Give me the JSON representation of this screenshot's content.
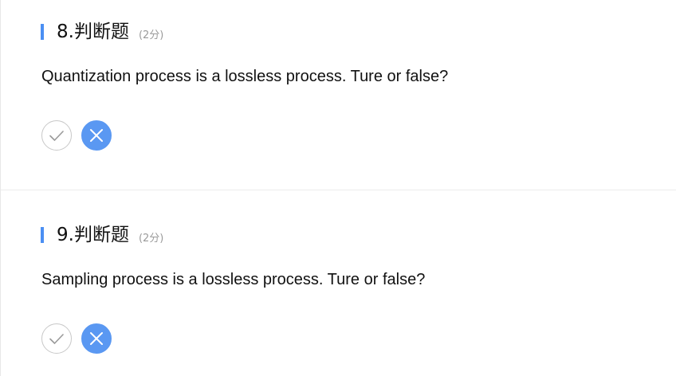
{
  "questions": [
    {
      "title": "8.判断题",
      "score": "(2分)",
      "text": "Quantization process is a lossless process. Ture or false?",
      "options": [
        {
          "icon": "check-icon",
          "selected": false
        },
        {
          "icon": "cross-icon",
          "selected": true
        }
      ]
    },
    {
      "title": "9.判断题",
      "score": "(2分)",
      "text": "Sampling process is a lossless process. Ture or false?",
      "options": [
        {
          "icon": "check-icon",
          "selected": false
        },
        {
          "icon": "cross-icon",
          "selected": true
        }
      ]
    }
  ],
  "colors": {
    "accent": "#4b8ff3",
    "selected_fill": "#5a98f2",
    "unselected_border": "#c8c8c8",
    "score_text": "#9b9b9b"
  }
}
